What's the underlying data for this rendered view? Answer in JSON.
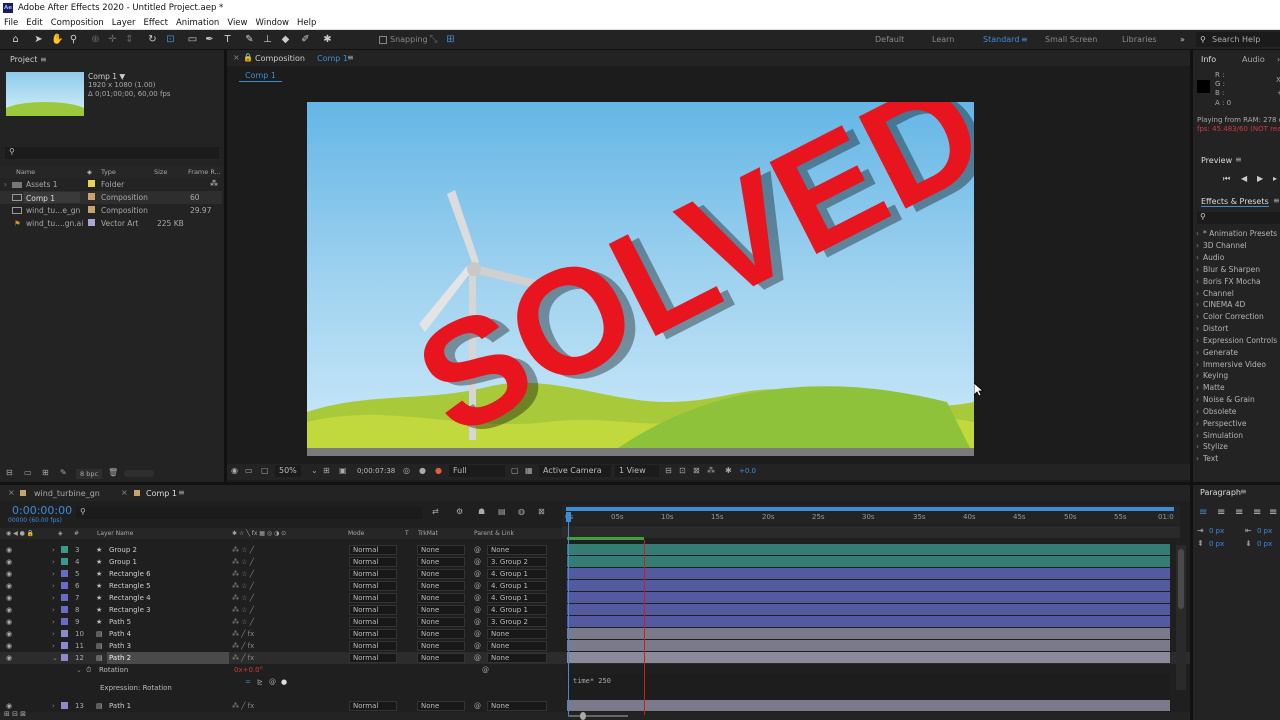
{
  "titlebar": {
    "app_icon": "Ae",
    "title": "Adobe After Effects 2020 - Untitled Project.aep *"
  },
  "menu": [
    "File",
    "Edit",
    "Composition",
    "Layer",
    "Effect",
    "Animation",
    "View",
    "Window",
    "Help"
  ],
  "toolbar": {
    "snapping_label": "Snapping",
    "workspaces": [
      "Default",
      "Learn",
      "Standard",
      "Small Screen",
      "Libraries"
    ],
    "active_workspace": "Standard",
    "search_placeholder": "Search Help"
  },
  "project": {
    "tab": "Project",
    "comp_name": "Comp 1 ▼",
    "comp_res": "1920 x 1080 (1.00)",
    "comp_dur": "Δ 0;01;00;00, 60,00 fps",
    "columns": {
      "name": "Name",
      "type": "Type",
      "size": "Size",
      "frame": "Frame R..."
    },
    "rows": [
      {
        "name": "Assets 1",
        "type": "Folder",
        "size": "",
        "frame": "",
        "color": "#e8d44d"
      },
      {
        "name": "Comp 1",
        "type": "Composition",
        "size": "",
        "frame": "60",
        "color": "#c9a36b"
      },
      {
        "name": "wind_tu...e_gn",
        "type": "Composition",
        "size": "",
        "frame": "29.97",
        "color": "#c9a36b"
      },
      {
        "name": "wind_tu....gn.ai",
        "type": "Vector Art",
        "size": "225 KB",
        "frame": "",
        "color": "#a8a8d8"
      }
    ],
    "bpc": "8 bpc"
  },
  "composition": {
    "tab_label": "Composition",
    "tab_comp": "Comp 1",
    "sub_tab": "Comp 1",
    "overlay_text": "SOLVED",
    "zoom": "50%",
    "timecode": "0;00:07:38",
    "resolution": "Full",
    "camera": "Active Camera",
    "views": "1 View",
    "exposure": "+0.0"
  },
  "info": {
    "tab": "Info",
    "tab2": "Audio",
    "r": "R :",
    "g": "G :",
    "b": "B :",
    "a": "A : 0",
    "ram": "Playing from RAM: 278 o",
    "fps": "fps: 45.483/60 (NOT real"
  },
  "preview": {
    "tab": "Preview"
  },
  "effects": {
    "tab": "Effects & Presets",
    "items": [
      "* Animation Presets",
      "3D Channel",
      "Audio",
      "Blur & Sharpen",
      "Boris FX Mocha",
      "Channel",
      "CINEMA 4D",
      "Color Correction",
      "Distort",
      "Expression Controls",
      "Generate",
      "Immersive Video",
      "Keying",
      "Matte",
      "Noise & Grain",
      "Obsolete",
      "Perspective",
      "Simulation",
      "Stylize",
      "Text"
    ]
  },
  "paragraph": {
    "tab": "Paragraph",
    "v1": "0 px",
    "v2": "0 px",
    "v3": "0 px",
    "v4": "0 px"
  },
  "timeline": {
    "tab1": "wind_turbine_gn",
    "tab2": "Comp 1",
    "current_time": "0:00:00:00",
    "frame_info": "00000 (60.00 fps)",
    "headers": {
      "num": "#",
      "layer": "Layer Name",
      "mode": "Mode",
      "t": "T",
      "trkmat": "TrkMat",
      "parent": "Parent & Link"
    },
    "ruler": [
      "0s",
      "05s",
      "10s",
      "15s",
      "20s",
      "25s",
      "30s",
      "35s",
      "40s",
      "45s",
      "50s",
      "55s",
      "01:0"
    ],
    "layers": [
      {
        "num": "3",
        "name": "Group 2",
        "mode": "Normal",
        "trk": "None",
        "parent": "None",
        "color": "#3a9a8a",
        "bar": "#357d74"
      },
      {
        "num": "4",
        "name": "Group 1",
        "mode": "Normal",
        "trk": "None",
        "parent": "3. Group 2",
        "color": "#3a9a8a",
        "bar": "#357d74"
      },
      {
        "num": "5",
        "name": "Rectangle 6",
        "mode": "Normal",
        "trk": "None",
        "parent": "4. Group 1",
        "color": "#6a6ac8",
        "bar": "#545aa0"
      },
      {
        "num": "6",
        "name": "Rectangle 5",
        "mode": "Normal",
        "trk": "None",
        "parent": "4. Group 1",
        "color": "#6a6ac8",
        "bar": "#545aa0"
      },
      {
        "num": "7",
        "name": "Rectangle 4",
        "mode": "Normal",
        "trk": "None",
        "parent": "4. Group 1",
        "color": "#6a6ac8",
        "bar": "#545aa0"
      },
      {
        "num": "8",
        "name": "Rectangle 3",
        "mode": "Normal",
        "trk": "None",
        "parent": "4. Group 1",
        "color": "#6a6ac8",
        "bar": "#545aa0"
      },
      {
        "num": "9",
        "name": "Path 5",
        "mode": "Normal",
        "trk": "None",
        "parent": "3. Group 2",
        "color": "#6a6ac8",
        "bar": "#545aa0"
      },
      {
        "num": "10",
        "name": "Path 4",
        "mode": "Normal",
        "trk": "None",
        "parent": "None",
        "color": "#8a8acc",
        "bar": "#7a7a8a"
      },
      {
        "num": "11",
        "name": "Path 3",
        "mode": "Normal",
        "trk": "None",
        "parent": "None",
        "color": "#8a8acc",
        "bar": "#7a7a8a"
      },
      {
        "num": "12",
        "name": "Path 2",
        "mode": "Normal",
        "trk": "None",
        "parent": "None",
        "color": "#8a8acc",
        "bar": "#8a8a9a"
      }
    ],
    "rotation_label": "Rotation",
    "rotation_value": "0x+0.0°",
    "expression_label": "Expression: Rotation",
    "expression_text": "time* 250",
    "last_layer": {
      "num": "13",
      "name": "Path 1",
      "mode": "Normal",
      "trk": "None",
      "parent": "None",
      "color": "#8a8acc",
      "bar": "#7a7a8a"
    }
  },
  "colors": {
    "accent": "#3f8bd6",
    "overlay": "#e8141e",
    "playhead": "#d01c1c"
  }
}
